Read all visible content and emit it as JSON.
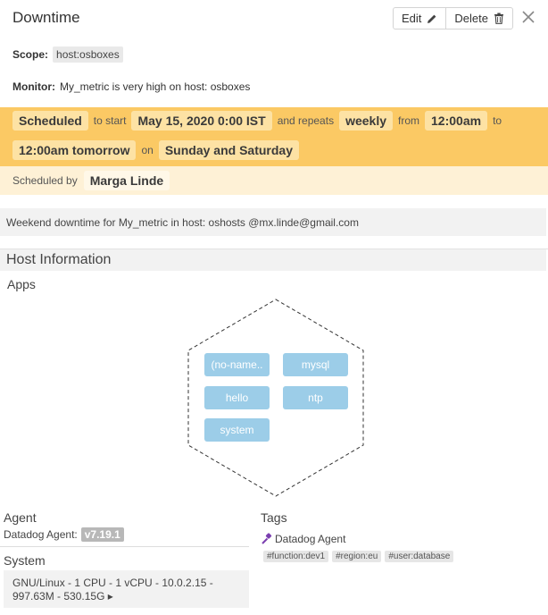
{
  "header": {
    "title": "Downtime",
    "edit_label": "Edit",
    "delete_label": "Delete"
  },
  "scope": {
    "label": "Scope:",
    "value": "host:osboxes"
  },
  "monitor": {
    "label": "Monitor:",
    "value": "My_metric is very high on host: osboxes"
  },
  "schedule": {
    "status": "Scheduled",
    "to_start_text": "to start",
    "start": "May 15, 2020 0:00 IST",
    "repeats_text": "and repeats",
    "frequency": "weekly",
    "from_text": "from",
    "from_time": "12:00am",
    "to_text": "to",
    "to_time": "12:00am tomorrow",
    "on_text": "on",
    "days": "Sunday and Saturday",
    "scheduled_by_text": "Scheduled by",
    "scheduled_by": "Marga Linde",
    "banner_color": "#fbc964"
  },
  "message": "Weekend downtime for My_metric in host: oshosts @mx.linde@gmail.com",
  "host_info": {
    "title": "Host Information",
    "apps_label": "Apps",
    "apps": [
      "(no-name..",
      "mysql",
      "hello",
      "ntp",
      "system"
    ],
    "app_color": "#9ccde8",
    "agent_label": "Agent",
    "agent_text": "Datadog Agent:",
    "agent_version": "v7.19.1",
    "system_label": "System",
    "system_value": "GNU/Linux - 1 CPU - 1 vCPU - 10.0.2.15 - 997.63M - 530.15G ▸",
    "tags_label": "Tags",
    "tag_source": "Datadog Agent",
    "tags": [
      "#function:dev1",
      "#region:eu",
      "#user:database"
    ]
  }
}
